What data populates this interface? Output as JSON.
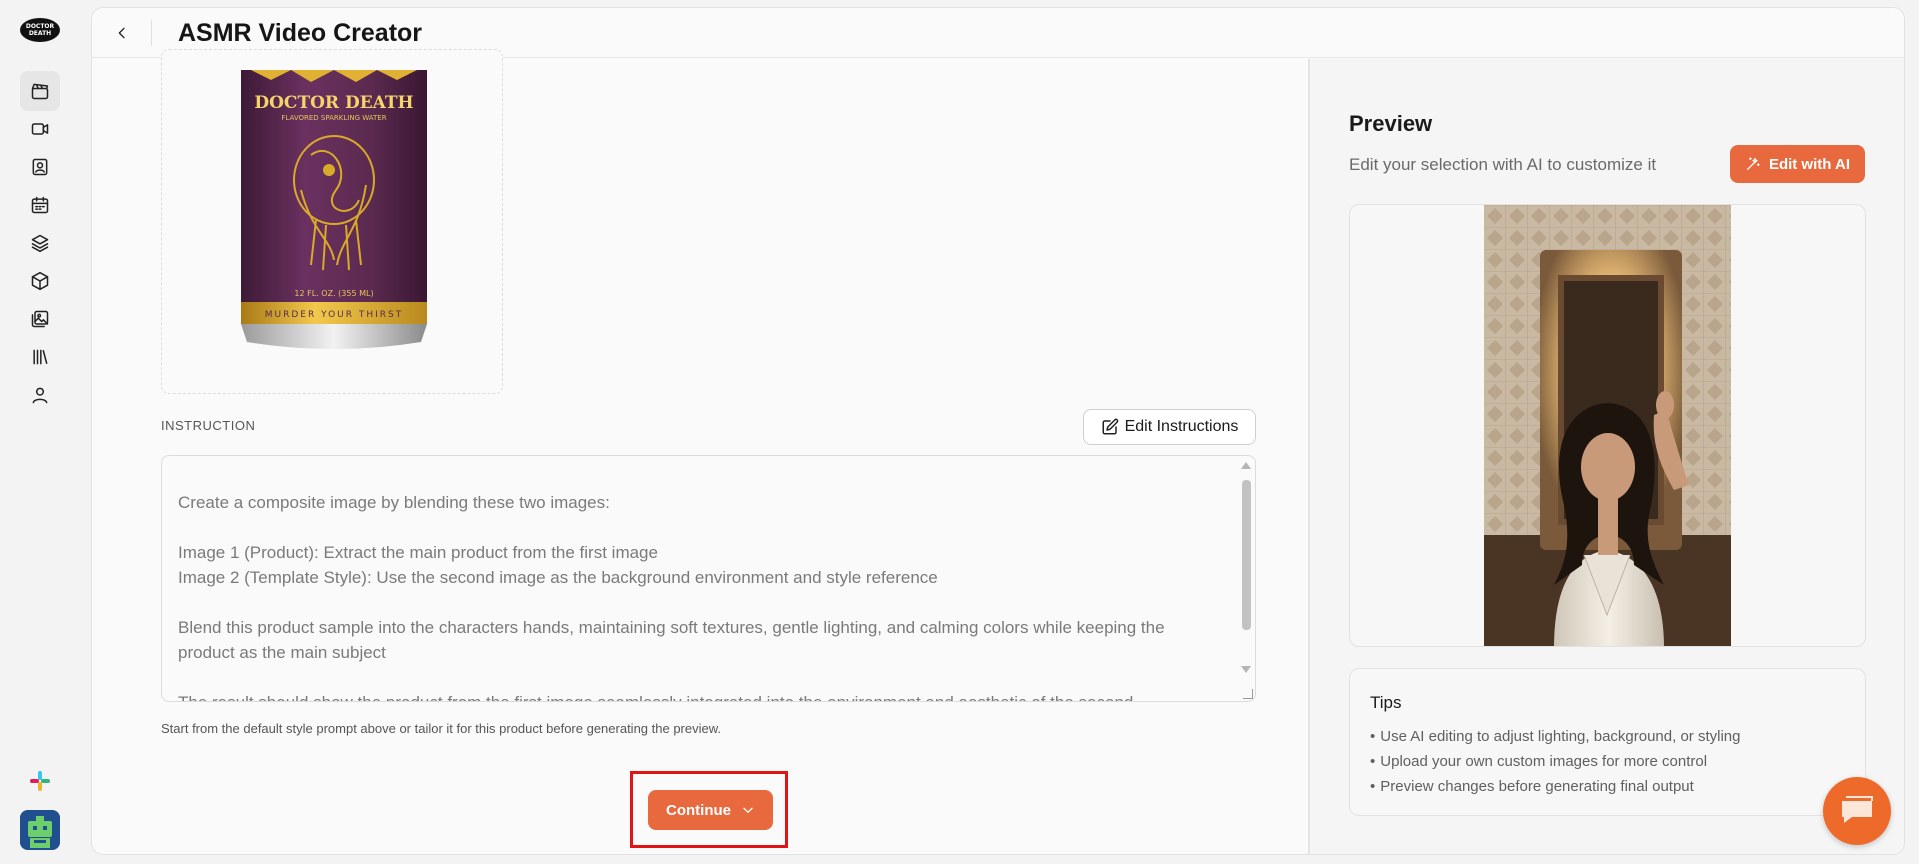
{
  "rail": {
    "logo_text": "DOCTOR DEATH",
    "items": [
      "clapperboard-icon",
      "video-icon",
      "contact-icon",
      "calendar-icon",
      "layers-icon",
      "box-icon",
      "gallery-icon",
      "library-icon",
      "user-icon"
    ],
    "active_index": 0
  },
  "header": {
    "title": "ASMR Video Creator"
  },
  "product": {
    "brand": "DOCTOR DEATH",
    "tagline": "FLAVORED SPARKLING WATER",
    "volume": "12 FL. OZ. (355 ML)",
    "slogan": "MURDER YOUR THIRST"
  },
  "instruction": {
    "label": "INSTRUCTION",
    "edit_button": "Edit Instructions",
    "lines": [
      "Create a composite image by blending these two images:",
      "Image 1 (Product): Extract the main product from the first image",
      "Image 2 (Template Style): Use the second image as the background environment and style reference",
      "Blend this product sample into the characters hands, maintaining soft textures, gentle lighting, and calming colors while keeping the product as the main subject",
      "The result should show the product from the first image seamlessly integrated into the environment and aesthetic of the second"
    ],
    "hint": "Start from the default style prompt above or tailor it for this product before generating the preview."
  },
  "continue_button": "Continue",
  "preview": {
    "title": "Preview",
    "subtitle": "Edit your selection with AI to customize it",
    "edit_ai_button": "Edit with AI"
  },
  "tips": {
    "title": "Tips",
    "items": [
      "Use AI editing to adjust lighting, background, or styling",
      "Upload your own custom images for more control",
      "Preview changes before generating final output"
    ]
  },
  "colors": {
    "accent": "#e8693e",
    "highlight_border": "#e01414",
    "can_purple": "#5b2a4f",
    "can_gold": "#d9a928"
  }
}
